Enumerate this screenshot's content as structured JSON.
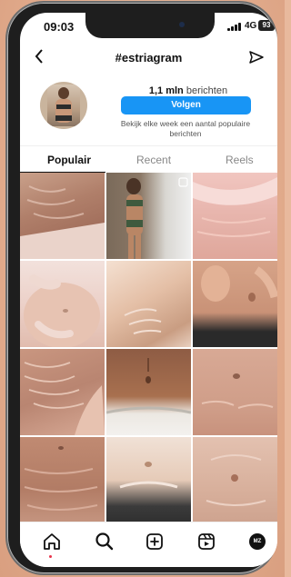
{
  "status_bar": {
    "time": "09:03",
    "network": "4G",
    "battery": "93"
  },
  "header": {
    "title": "#estriagram"
  },
  "profile": {
    "count": "1,1 mln",
    "count_label": "berichten",
    "follow_label": "Volgen",
    "description": "Bekijk elke week een aantal populaire berichten"
  },
  "tabs": [
    {
      "label": "Populair",
      "active": true
    },
    {
      "label": "Recent",
      "active": false
    },
    {
      "label": "Reels",
      "active": false
    }
  ],
  "bottom_nav": [
    {
      "icon": "home-icon"
    },
    {
      "icon": "search-icon"
    },
    {
      "icon": "create-post-icon"
    },
    {
      "icon": "reels-icon"
    },
    {
      "icon": "profile-avatar",
      "initials": "MZ"
    }
  ],
  "colors": {
    "accent": "#1895f5",
    "notification_dot": "#e8334a"
  }
}
